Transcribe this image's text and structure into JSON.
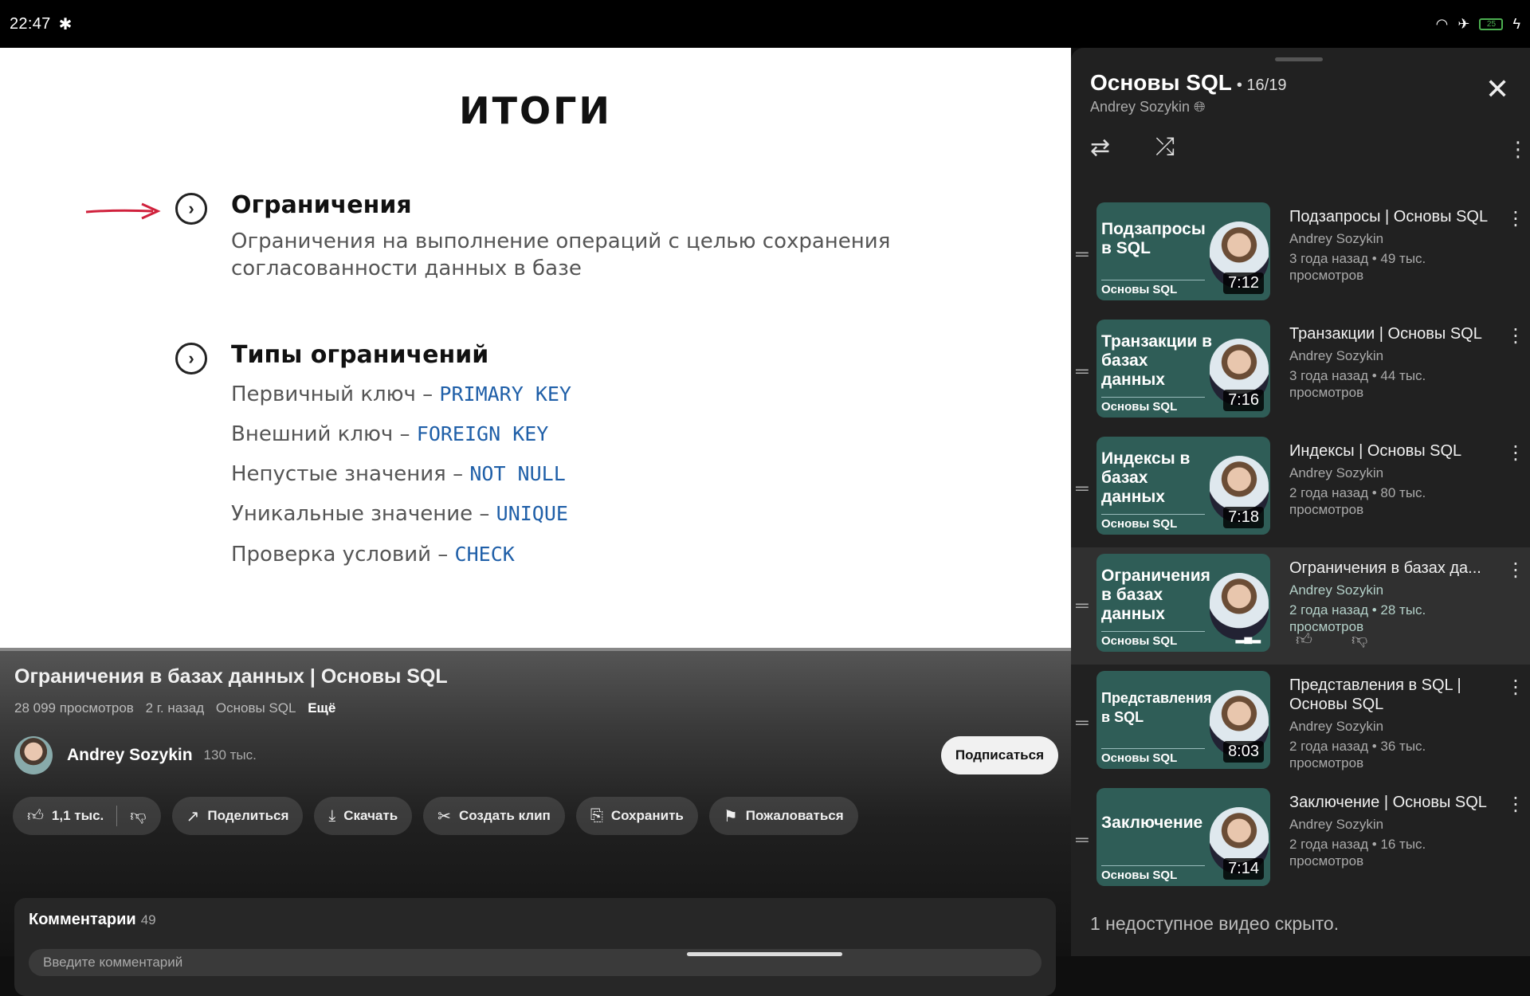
{
  "status": {
    "time": "22:47",
    "battery": "25"
  },
  "slide": {
    "title": "ИТОГИ",
    "item1_title": "Ограничения",
    "item1_desc": "Ограничения на выполнение операций с целью сохранения согласованности данных в базе",
    "item2_title": "Типы ограничений",
    "types": [
      {
        "label": "Первичный ключ – ",
        "kw": "PRIMARY KEY"
      },
      {
        "label": "Внешний ключ – ",
        "kw": "FOREIGN KEY"
      },
      {
        "label": "Непустые значения – ",
        "kw": "NOT NULL"
      },
      {
        "label": "Уникальные значение – ",
        "kw": "UNIQUE"
      },
      {
        "label": "Проверка условий – ",
        "kw": "CHECK"
      }
    ]
  },
  "video": {
    "title": "Ограничения в базах данных | Основы SQL",
    "views": "28 099 просмотров",
    "age": "2 г. назад",
    "playlist": "Основы SQL",
    "more": "Ещё",
    "channel": "Andrey Sozykin",
    "subs": "130 тыс.",
    "subscribe": "Подписаться",
    "likes": "1,1 тыс.",
    "share": "Поделиться",
    "download": "Скачать",
    "clip": "Создать клип",
    "save": "Сохранить",
    "report": "Пожаловаться",
    "comments_label": "Комментарии",
    "comments_count": "49",
    "comment_placeholder": "Введите комментарий"
  },
  "panel": {
    "title": "Основы SQL",
    "position": "• 16/19",
    "author": "Andrey Sozykin",
    "hidden_note": "1 недоступное видео скрыто."
  },
  "playlist": [
    {
      "thumb": "Подзапросы в SQL",
      "series": "Основы SQL",
      "duration": "7:12",
      "title": "Подзапросы | Основы SQL",
      "author": "Andrey Sozykin",
      "meta": "3 года назад • 49 тыс. просмотров"
    },
    {
      "thumb": "Транзакции в базах данных",
      "series": "Основы SQL",
      "duration": "7:16",
      "title": "Транзакции | Основы SQL",
      "author": "Andrey Sozykin",
      "meta": "3 года назад • 44 тыс. просмотров"
    },
    {
      "thumb": "Индексы в базах данных",
      "series": "Основы SQL",
      "duration": "7:18",
      "title": "Индексы | Основы SQL",
      "author": "Andrey Sozykin",
      "meta": "2 года назад • 80 тыс. просмотров"
    },
    {
      "thumb": "Ограничения в базах данных",
      "series": "Основы SQL",
      "duration": "",
      "title": "Ограничения в базах да...",
      "author": "Andrey Sozykin",
      "meta": "2 года назад • 28 тыс. просмотров"
    },
    {
      "thumb": "Представления в SQL",
      "series": "Основы SQL",
      "duration": "8:03",
      "title": "Представления в SQL | Основы SQL",
      "author": "Andrey Sozykin",
      "meta": "2 года назад • 36 тыс. просмотров"
    },
    {
      "thumb": "Заключение",
      "series": "Основы SQL",
      "duration": "7:14",
      "title": "Заключение | Основы SQL",
      "author": "Andrey Sozykin",
      "meta": "2 года назад • 16 тыс. просмотров"
    }
  ]
}
